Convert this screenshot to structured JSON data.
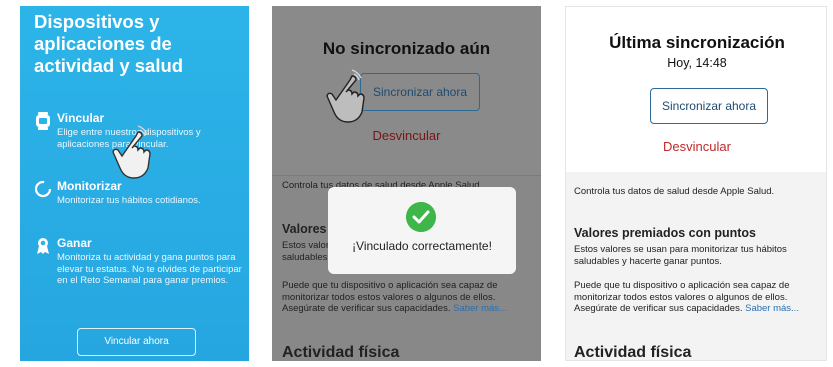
{
  "panel1": {
    "title": "Dispositivos y aplicaciones de actividad y salud",
    "items": [
      {
        "heading": "Vincular",
        "icon": "watch-icon",
        "desc": "Elige entre nuestros dispositivos y aplicaciones para vincular."
      },
      {
        "heading": "Monitorizar",
        "icon": "progress-ring-icon",
        "desc": "Monitorizar tus hábitos cotidianos."
      },
      {
        "heading": "Ganar",
        "icon": "ribbon-award-icon",
        "desc": "Monitoriza tu actividad y gana puntos para elevar tu estatus. No te olvides de participar en el Reto Semanal para ganar premios."
      }
    ],
    "button": "Vincular ahora"
  },
  "panel2": {
    "title": "No sincronizado aún",
    "sync_button": "Sincronizar ahora",
    "unlink": "Desvincular",
    "health_text": "Controla tus datos de salud desde Apple Salud.",
    "values_title": "Valores premiados con puntos",
    "values_desc": "Estos valores se usan para monitorizar tus hábitos saludables y hacerte ganar puntos.",
    "capabilities": "Puede que tu dispositivo o aplicación sea capaz de monitorizar todos estos valores o algunos de ellos. Asegúrate de verificar sus capacidades.",
    "more_link": "Saber más...",
    "activity_title": "Actividad física",
    "modal_text": "¡Vinculado correctamente!"
  },
  "panel3": {
    "title": "Última sincronización",
    "time": "Hoy, 14:48",
    "sync_button": "Sincronizar ahora",
    "unlink": "Desvincular",
    "health_text": "Controla tus datos de salud desde Apple Salud.",
    "values_title": "Valores premiados con puntos",
    "values_desc": "Estos valores se usan para monitorizar tus hábitos saludables y hacerte ganar puntos.",
    "capabilities": "Puede que tu dispositivo o aplicación sea capaz de monitorizar todos estos valores o algunos de ellos. Asegúrate de verificar sus capacidades.",
    "more_link": "Saber más...",
    "activity_title": "Actividad física"
  },
  "colors": {
    "accent_blue": "#2cb4e8",
    "link": "#2a6fb0",
    "unlink_red": "#c02a2a",
    "success_green": "#3fb64a"
  }
}
